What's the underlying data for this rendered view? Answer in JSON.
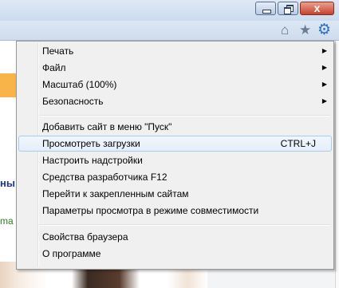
{
  "window": {
    "close_label": "x"
  },
  "toolbar": {
    "home_icon": "home-icon",
    "favorites_icon": "star-icon",
    "tools_icon": "gear-icon"
  },
  "page_fragments": {
    "heading_fragment": "ны",
    "green_fragment": "ma"
  },
  "menu": {
    "items": [
      {
        "label": "Печать",
        "submenu": true
      },
      {
        "label": "Файл",
        "submenu": true
      },
      {
        "label": "Масштаб (100%)",
        "submenu": true
      },
      {
        "label": "Безопасность",
        "submenu": true
      },
      {
        "label": "Добавить сайт в меню \"Пуск\""
      },
      {
        "label": "Просмотреть загрузки",
        "shortcut": "CTRL+J",
        "highlighted": true
      },
      {
        "label": "Настроить надстройки"
      },
      {
        "label": "Средства разработчика F12"
      },
      {
        "label": "Перейти к закрепленным сайтам"
      },
      {
        "label": "Параметры просмотра в режиме совместимости"
      },
      {
        "label": "Свойства браузера"
      },
      {
        "label": "О программе"
      }
    ],
    "submenu_arrow": "▶"
  }
}
